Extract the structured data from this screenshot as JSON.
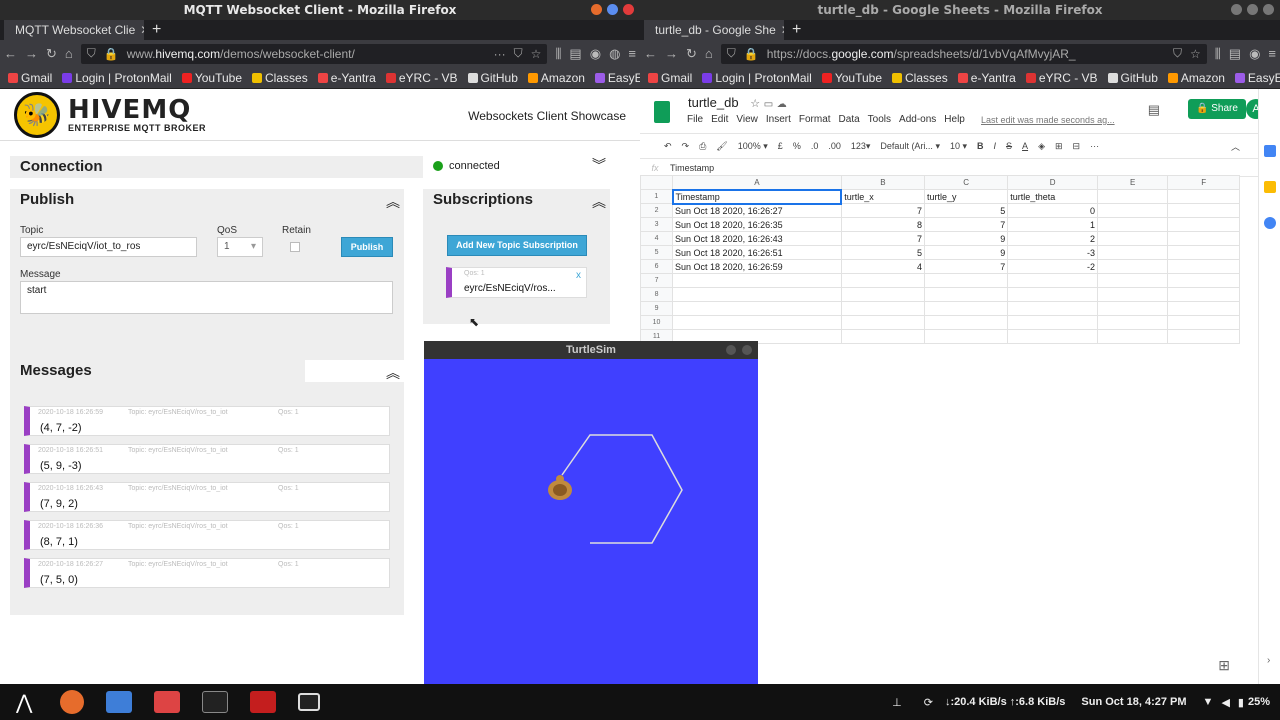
{
  "left_window": {
    "title": "MQTT Websocket Client - Mozilla Firefox",
    "tab_label": "MQTT Websocket Clie",
    "url_prefix": "www.",
    "url_domain": "hivemq.com",
    "url_path": "/demos/websocket-client/",
    "bookmarks": [
      "Gmail",
      "Login | ProtonMail",
      "YouTube",
      "Classes",
      "e-Yantra",
      "eYRC - VB",
      "GitHub",
      "Amazon",
      "EasyEDA"
    ]
  },
  "hivemq": {
    "logo_big": "HIVEMQ",
    "logo_small": "ENTERPRISE MQTT BROKER",
    "showcase": "Websockets Client Showcase",
    "connection_title": "Connection",
    "status": "connected",
    "publish_title": "Publish",
    "topic_label": "Topic",
    "topic_value": "eyrc/EsNEciqV/iot_to_ros",
    "qos_label": "QoS",
    "qos_value": "1",
    "retain_label": "Retain",
    "publish_button": "Publish",
    "message_label": "Message",
    "message_value": "start",
    "subscriptions_title": "Subscriptions",
    "add_subscription": "Add New Topic Subscription",
    "sub_qos": "Qos: 1",
    "sub_topic": "eyrc/EsNEciqV/ros...",
    "sub_close": "x",
    "messages_title": "Messages",
    "messages": [
      {
        "time": "2020-10-18 16:26:59",
        "topic": "Topic: eyrc/EsNEciqV/ros_to_iot",
        "qos": "Qos: 1",
        "payload": "(4, 7, -2)"
      },
      {
        "time": "2020-10-18 16:26:51",
        "topic": "Topic: eyrc/EsNEciqV/ros_to_iot",
        "qos": "Qos: 1",
        "payload": "(5, 9, -3)"
      },
      {
        "time": "2020-10-18 16:26:43",
        "topic": "Topic: eyrc/EsNEciqV/ros_to_iot",
        "qos": "Qos: 1",
        "payload": "(7, 9, 2)"
      },
      {
        "time": "2020-10-18 16:26:36",
        "topic": "Topic: eyrc/EsNEciqV/ros_to_iot",
        "qos": "Qos: 1",
        "payload": "(8, 7, 1)"
      },
      {
        "time": "2020-10-18 16:26:27",
        "topic": "Topic: eyrc/EsNEciqV/ros_to_iot",
        "qos": "Qos: 1",
        "payload": "(7, 5, 0)"
      }
    ]
  },
  "right_window": {
    "title": "turtle_db - Google Sheets - Mozilla Firefox",
    "tab_label": "turtle_db - Google She",
    "url_prefix": "https://docs.",
    "url_domain": "google.com",
    "url_path": "/spreadsheets/d/1vbVqAfMvyjAR_",
    "bookmarks": [
      "Gmail",
      "Login | ProtonMail",
      "YouTube",
      "Classes",
      "e-Yantra",
      "eYRC - VB",
      "GitHub",
      "Amazon",
      "EasyEDA"
    ]
  },
  "sheets": {
    "doc_title": "turtle_db",
    "menu": [
      "File",
      "Edit",
      "View",
      "Insert",
      "Format",
      "Data",
      "Tools",
      "Add-ons",
      "Help"
    ],
    "last_edit": "Last edit was made seconds ag...",
    "share": "Share",
    "avatar": "A",
    "zoom": "100%",
    "currency": "£",
    "percent": "%",
    "dec_less": ".0",
    "dec_more": ".00",
    "format_123": "123",
    "font": "Default (Ari...",
    "font_size": "10",
    "formula_value": "Timestamp",
    "col_headers": [
      "A",
      "B",
      "C",
      "D",
      "E",
      "F"
    ],
    "rows": [
      [
        "Timestamp",
        "turtle_x",
        "turtle_y",
        "turtle_theta",
        "",
        ""
      ],
      [
        "Sun Oct 18 2020, 16:26:27",
        "7",
        "5",
        "0",
        "",
        ""
      ],
      [
        "Sun Oct 18 2020, 16:26:35",
        "8",
        "7",
        "1",
        "",
        ""
      ],
      [
        "Sun Oct 18 2020, 16:26:43",
        "7",
        "9",
        "2",
        "",
        ""
      ],
      [
        "Sun Oct 18 2020, 16:26:51",
        "5",
        "9",
        "-3",
        "",
        ""
      ],
      [
        "Sun Oct 18 2020, 16:26:59",
        "4",
        "7",
        "-2",
        "",
        ""
      ],
      [
        "",
        "",
        "",
        "",
        "",
        ""
      ],
      [
        "",
        "",
        "",
        "",
        "",
        ""
      ],
      [
        "",
        "",
        "",
        "",
        "",
        ""
      ],
      [
        "",
        "",
        "",
        "",
        "",
        ""
      ],
      [
        "",
        "",
        "",
        "",
        "",
        ""
      ]
    ]
  },
  "turtlesim": {
    "title": "TurtleSim",
    "bg_color": "#4040ff"
  },
  "taskbar": {
    "network": "↓:20.4 KiB/s ↑:6.8 KiB/s",
    "datetime": "Sun Oct 18,  4:27 PM",
    "battery": "25%"
  }
}
